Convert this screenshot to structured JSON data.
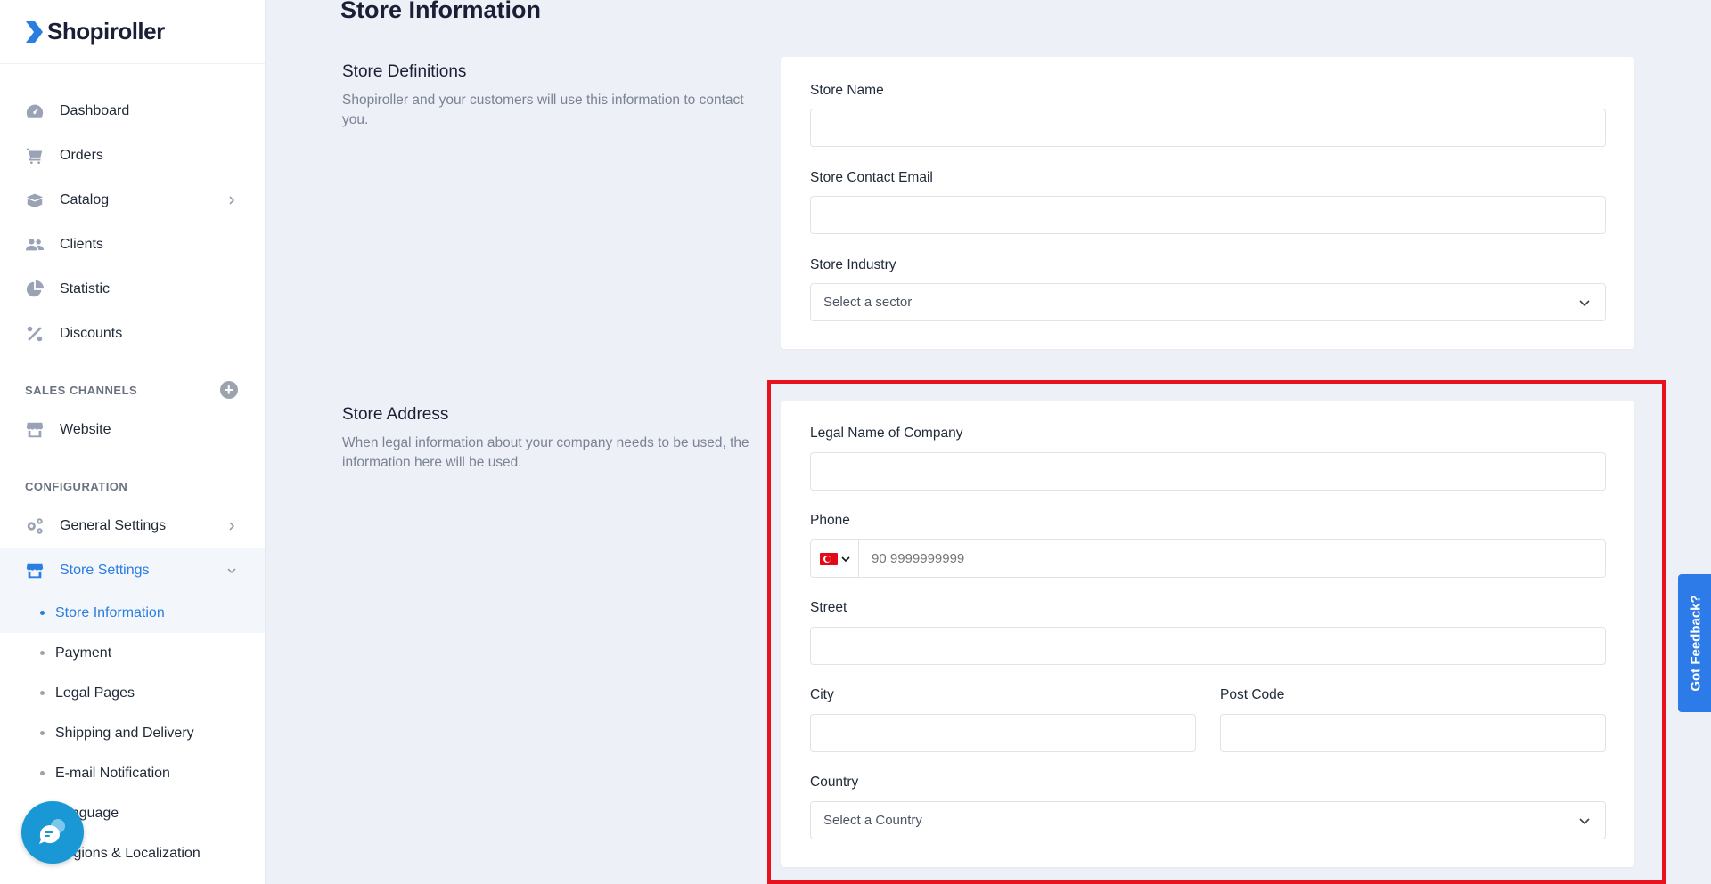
{
  "brand": {
    "name": "Shopiroller"
  },
  "sidebar": {
    "main_items": [
      {
        "label": "Dashboard",
        "icon": "dashboard-icon"
      },
      {
        "label": "Orders",
        "icon": "cart-icon"
      },
      {
        "label": "Catalog",
        "icon": "catalog-icon",
        "has_children": true
      },
      {
        "label": "Clients",
        "icon": "users-icon"
      },
      {
        "label": "Statistic",
        "icon": "pie-chart-icon"
      },
      {
        "label": "Discounts",
        "icon": "percent-icon"
      }
    ],
    "sales_channels_title": "SALES CHANNELS",
    "sales_channels": [
      {
        "label": "Website",
        "icon": "store-icon"
      }
    ],
    "configuration_title": "CONFIGURATION",
    "configuration": [
      {
        "label": "General Settings",
        "icon": "gears-icon"
      },
      {
        "label": "Store Settings",
        "icon": "store-icon",
        "expanded": true
      }
    ],
    "store_settings_sub": [
      {
        "label": "Store Information",
        "active": true
      },
      {
        "label": "Payment"
      },
      {
        "label": "Legal Pages"
      },
      {
        "label": "Shipping and Delivery"
      },
      {
        "label": "E-mail Notification"
      },
      {
        "label": "Language"
      },
      {
        "label": "Regions & Localization"
      }
    ]
  },
  "page": {
    "title": "Store Information",
    "definitions": {
      "title": "Store Definitions",
      "description": "Shopiroller and your customers will use this information to contact you.",
      "store_name_label": "Store Name",
      "store_name_value": "",
      "contact_email_label": "Store Contact Email",
      "contact_email_value": "",
      "industry_label": "Store Industry",
      "industry_placeholder": "Select a sector"
    },
    "address": {
      "title": "Store Address",
      "description": "When legal information about your company needs to be used, the information here will be used.",
      "legal_name_label": "Legal Name of Company",
      "phone_label": "Phone",
      "phone_placeholder": "90 9999999999",
      "phone_country_flag": "turkey-flag-icon",
      "street_label": "Street",
      "city_label": "City",
      "postcode_label": "Post Code",
      "country_label": "Country",
      "country_placeholder": "Select a Country"
    }
  },
  "feedback_label": "Got Feedback?",
  "colors": {
    "accent": "#2a7de1",
    "highlight": "#e8121e",
    "feedback": "#2d7be8",
    "chat": "#1a98d5"
  }
}
